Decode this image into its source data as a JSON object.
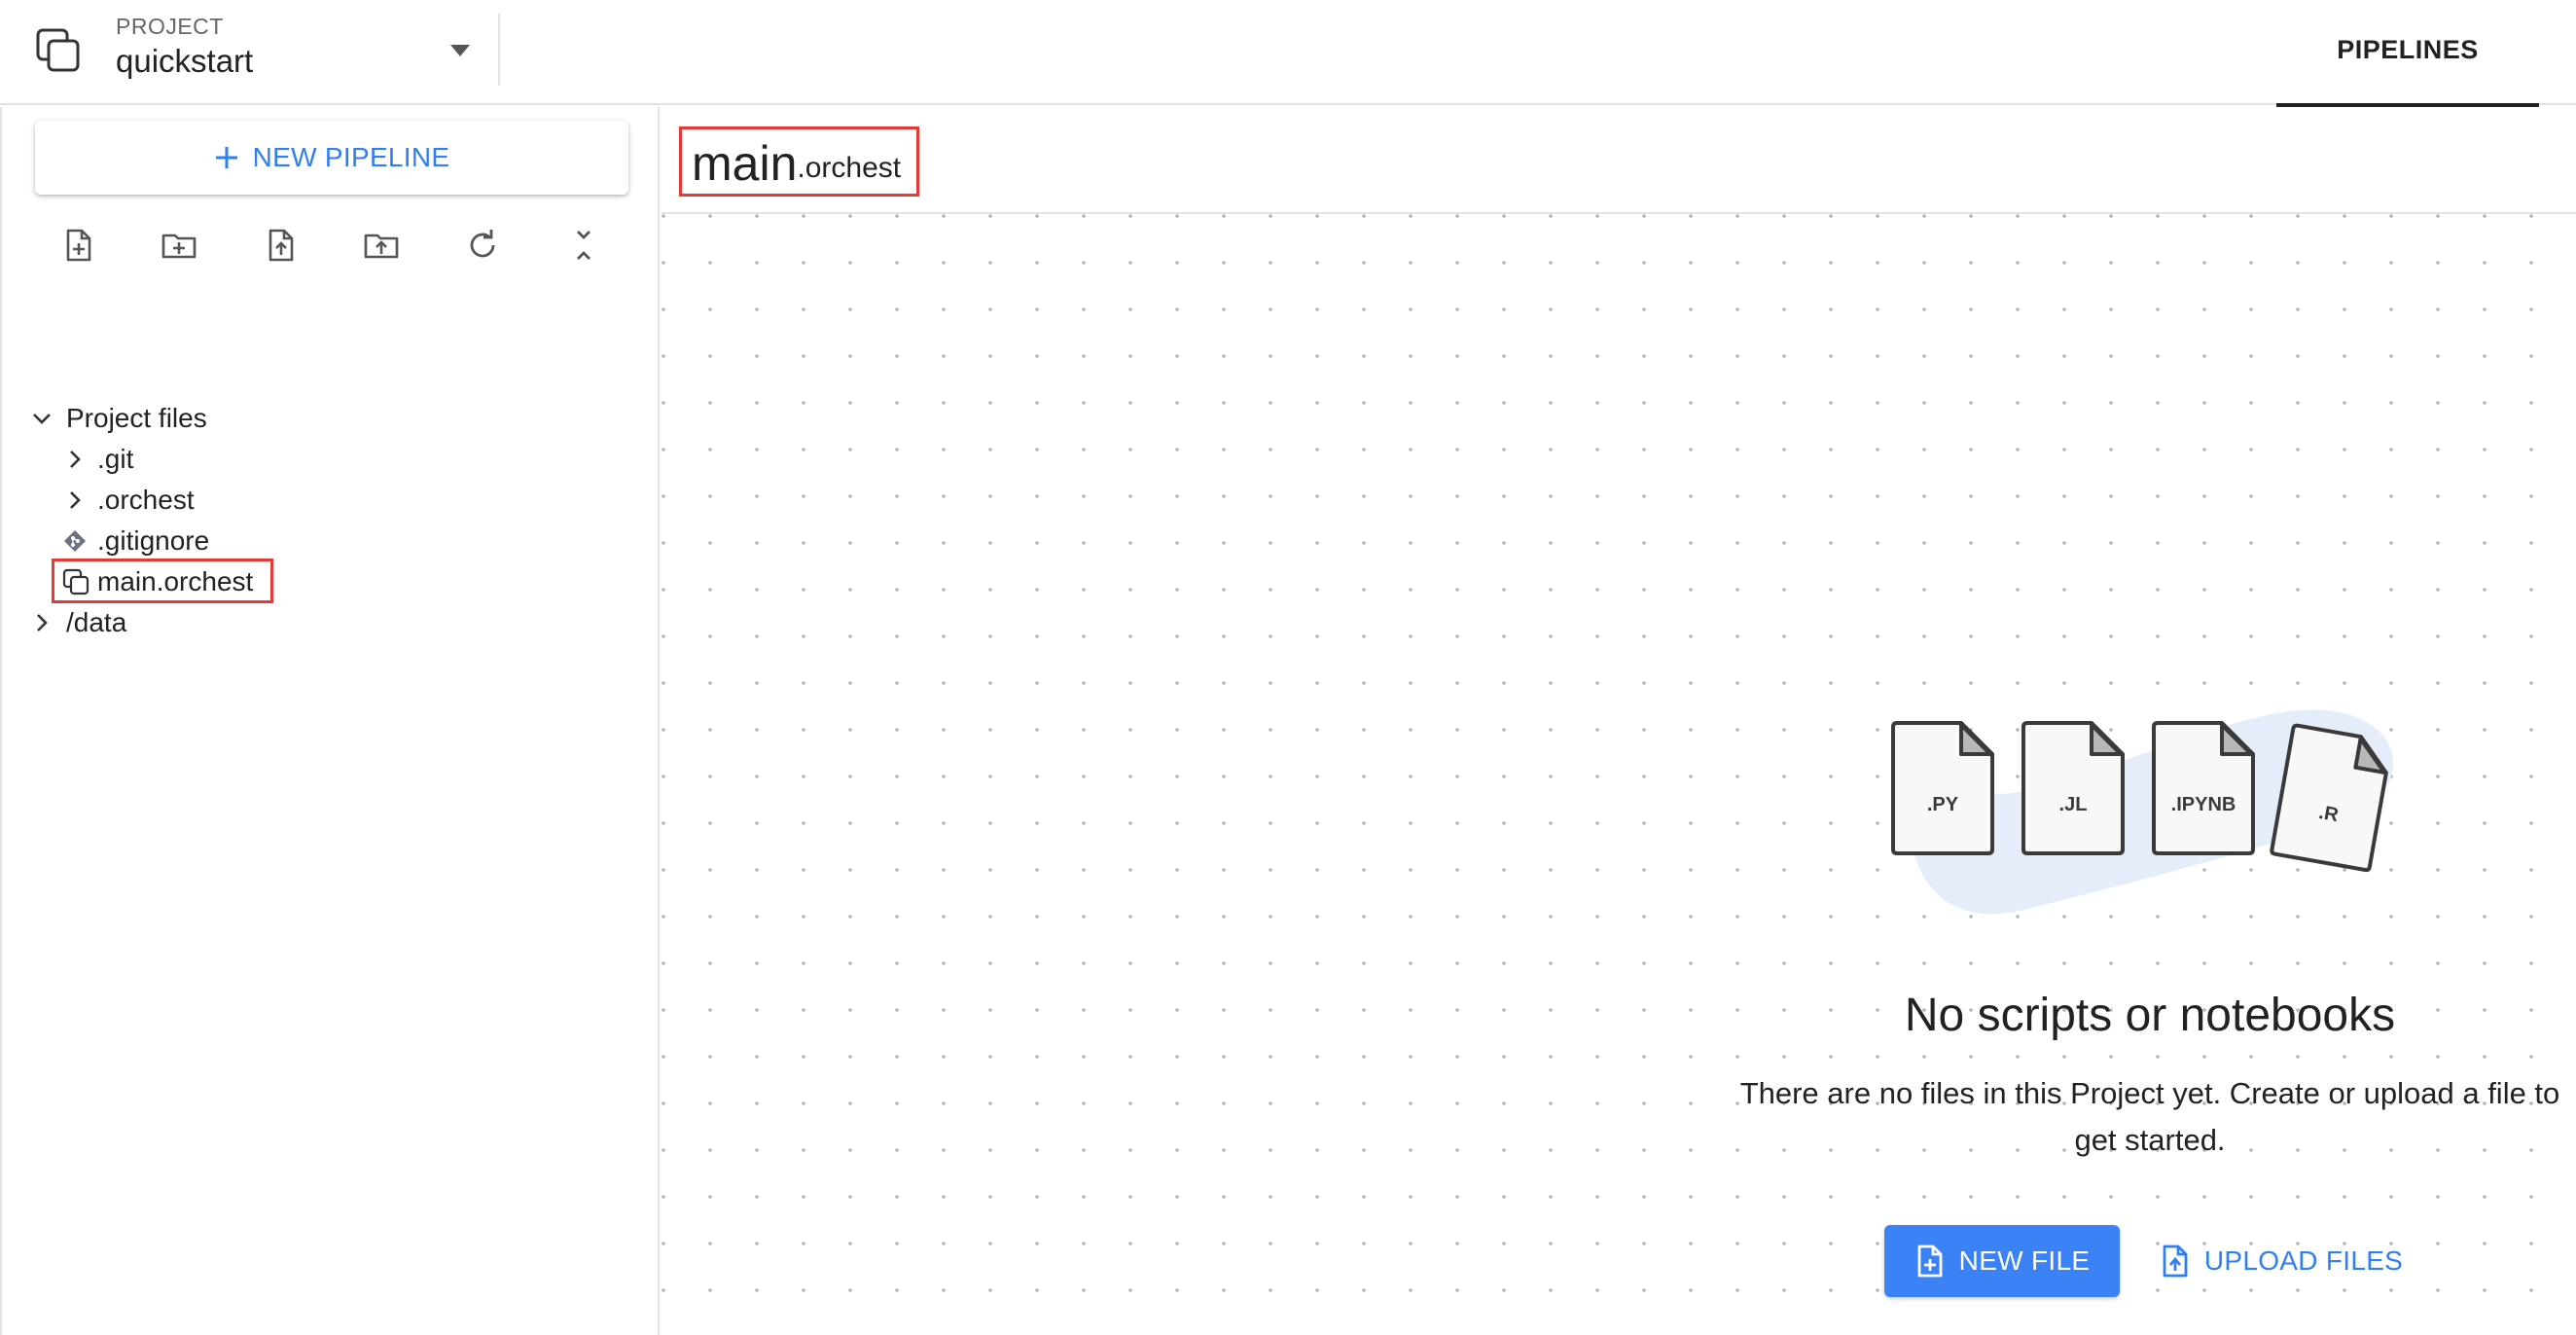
{
  "header": {
    "project_kicker": "PROJECT",
    "project_name": "quickstart",
    "tabs": [
      {
        "label": "PIPELINES",
        "active": true
      }
    ]
  },
  "sidebar": {
    "new_pipeline_label": "NEW PIPELINE",
    "toolbar_icons": [
      "new-file-icon",
      "new-folder-icon",
      "upload-file-icon",
      "upload-folder-icon",
      "refresh-icon",
      "collapse-all-icon"
    ],
    "tree": {
      "root_label": "Project files",
      "items": [
        {
          "label": ".git",
          "type": "folder",
          "expanded": false
        },
        {
          "label": ".orchest",
          "type": "folder",
          "expanded": false
        },
        {
          "label": ".gitignore",
          "type": "git-file"
        },
        {
          "label": "main.orchest",
          "type": "pipeline-file",
          "selected": true
        }
      ],
      "data_folder": {
        "label": "/data",
        "expanded": false
      }
    }
  },
  "main": {
    "pipeline_name": {
      "base": "main",
      "extension": ".orchest"
    },
    "empty_state": {
      "file_badges": [
        ".PY",
        ".JL",
        ".IPYNB",
        ".R"
      ],
      "title": "No scripts or notebooks",
      "description": "There are no files in this Project yet. Create or upload a file to get started.",
      "new_file_label": "NEW FILE",
      "upload_label": "UPLOAD FILES"
    }
  },
  "colors": {
    "accent": "#3b82f6",
    "link": "#2f7ff3",
    "highlight": "#e53935",
    "blob": "#e4edf9"
  }
}
